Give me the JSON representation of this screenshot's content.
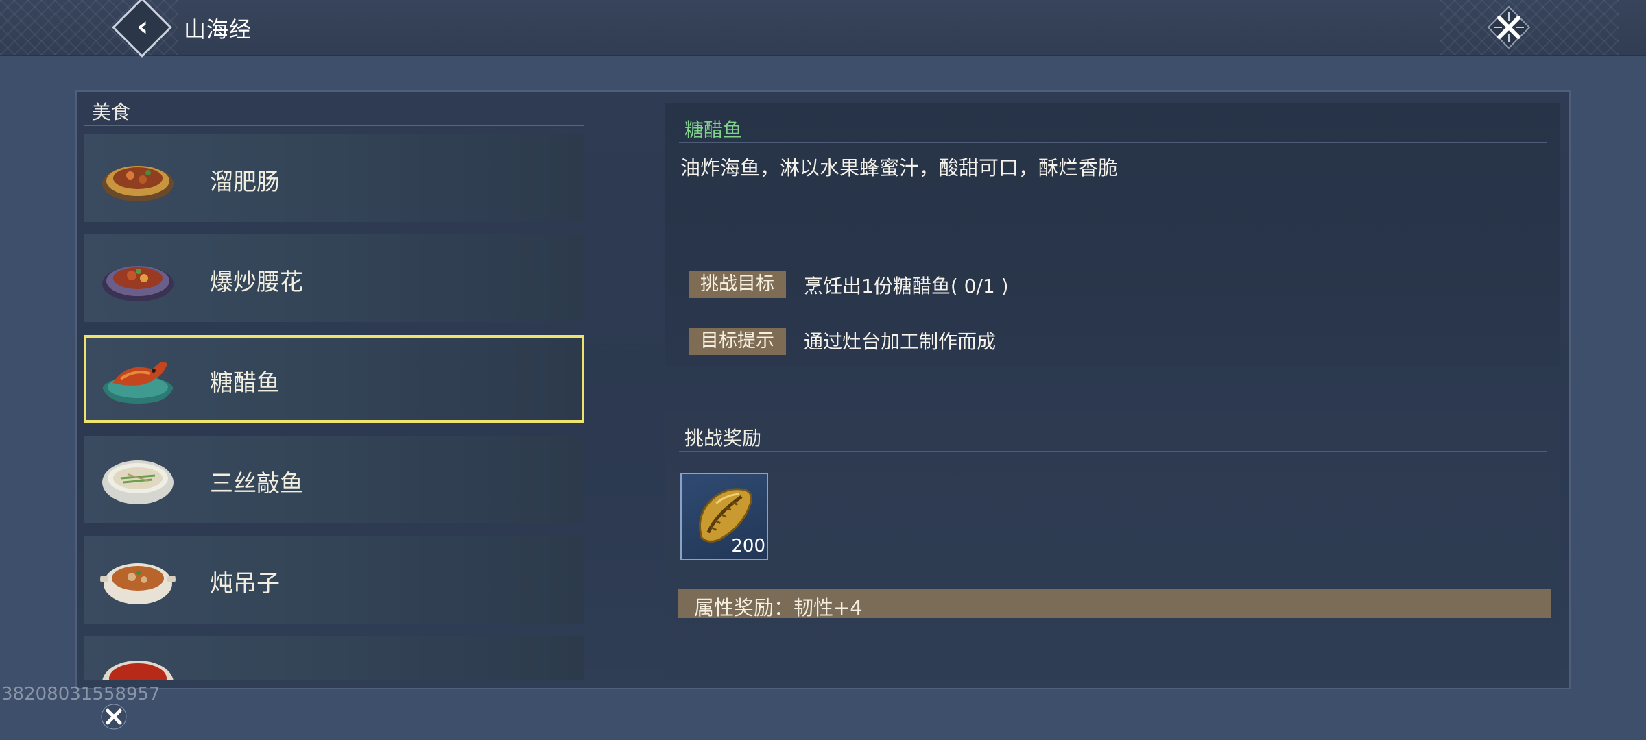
{
  "header": {
    "title": "山海经",
    "back_icon": "back-arrow-icon",
    "close_icon": "close-icon"
  },
  "list": {
    "category": "美食",
    "items": [
      {
        "label": "溜肥肠",
        "icon": "dish-sausage-icon",
        "selected": false
      },
      {
        "label": "爆炒腰花",
        "icon": "dish-kidney-icon",
        "selected": false
      },
      {
        "label": "糖醋鱼",
        "icon": "dish-fish-icon",
        "selected": true
      },
      {
        "label": "三丝敲鱼",
        "icon": "dish-soup-icon",
        "selected": false
      },
      {
        "label": "炖吊子",
        "icon": "dish-stew-icon",
        "selected": false
      },
      {
        "label": "",
        "icon": "dish-spicy-icon",
        "selected": false
      }
    ]
  },
  "detail": {
    "title": "糖醋鱼",
    "description": "油炸海鱼，淋以水果蜂蜜汁，酸甜可口，酥烂香脆",
    "goal_label": "挑战目标",
    "goal_value": "烹饪出1份糖醋鱼( 0/1 )",
    "hint_label": "目标提示",
    "hint_value": "通过灶台加工制作而成"
  },
  "reward": {
    "title": "挑战奖励",
    "item_icon": "shell-coin-icon",
    "item_quantity": "200",
    "attribute": "属性奖励：韧性+4"
  },
  "overlay": {
    "watermark": "38208031558957"
  },
  "colors": {
    "background": "#3e4f6b",
    "selected_border": "#eee36e",
    "title_green": "#7fd48a",
    "tag_bg": "#7e6c55"
  }
}
